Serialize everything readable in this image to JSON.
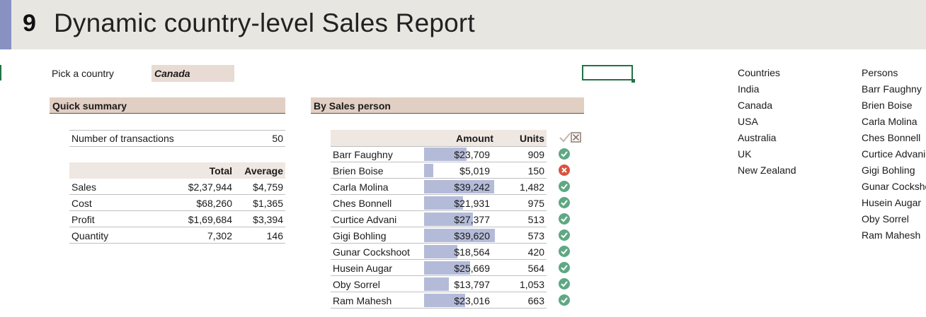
{
  "header": {
    "number": "9",
    "title": "Dynamic country-level Sales Report"
  },
  "picker": {
    "label": "Pick a country",
    "value": "Canada"
  },
  "quick_summary": {
    "title": "Quick summary",
    "transactions_label": "Number of transactions",
    "transactions_value": "50",
    "col_total": "Total",
    "col_average": "Average",
    "rows": [
      {
        "label": "Sales",
        "total": "$2,37,944",
        "average": "$4,759"
      },
      {
        "label": "Cost",
        "total": "$68,260",
        "average": "$1,365"
      },
      {
        "label": "Profit",
        "total": "$1,69,684",
        "average": "$3,394"
      },
      {
        "label": "Quantity",
        "total": "7,302",
        "average": "146"
      }
    ]
  },
  "by_sales_person": {
    "title": "By Sales person",
    "col_amount": "Amount",
    "col_units": "Units",
    "header_icons": [
      "check-icon",
      "cross-box-icon"
    ],
    "status_colors": {
      "ok": "#5fa884",
      "bad": "#d9513f"
    },
    "bar_color": "#b4bbd9",
    "rows": [
      {
        "name": "Barr Faughny",
        "amount": "$23,709",
        "amount_value": 23709,
        "units": "909",
        "status": "ok"
      },
      {
        "name": "Brien Boise",
        "amount": "$5,019",
        "amount_value": 5019,
        "units": "150",
        "status": "bad"
      },
      {
        "name": "Carla Molina",
        "amount": "$39,242",
        "amount_value": 39242,
        "units": "1,482",
        "status": "ok"
      },
      {
        "name": "Ches Bonnell",
        "amount": "$21,931",
        "amount_value": 21931,
        "units": "975",
        "status": "ok"
      },
      {
        "name": "Curtice Advani",
        "amount": "$27,377",
        "amount_value": 27377,
        "units": "513",
        "status": "ok"
      },
      {
        "name": "Gigi Bohling",
        "amount": "$39,620",
        "amount_value": 39620,
        "units": "573",
        "status": "ok"
      },
      {
        "name": "Gunar Cockshoot",
        "amount": "$18,564",
        "amount_value": 18564,
        "units": "420",
        "status": "ok"
      },
      {
        "name": "Husein Augar",
        "amount": "$25,669",
        "amount_value": 25669,
        "units": "564",
        "status": "ok"
      },
      {
        "name": "Oby Sorrel",
        "amount": "$13,797",
        "amount_value": 13797,
        "units": "1,053",
        "status": "ok"
      },
      {
        "name": "Ram Mahesh",
        "amount": "$23,016",
        "amount_value": 23016,
        "units": "663",
        "status": "ok"
      }
    ]
  },
  "countries": {
    "header": "Countries",
    "items": [
      "India",
      "Canada",
      "USA",
      "Australia",
      "UK",
      "New Zealand"
    ]
  },
  "persons": {
    "header": "Persons",
    "items": [
      "Barr Faughny",
      "Brien Boise",
      "Carla Molina",
      "Ches Bonnell",
      "Curtice Advani",
      "Gigi Bohling",
      "Gunar Cockshoot",
      "Husein Augar",
      "Oby Sorrel",
      "Ram Mahesh"
    ]
  }
}
